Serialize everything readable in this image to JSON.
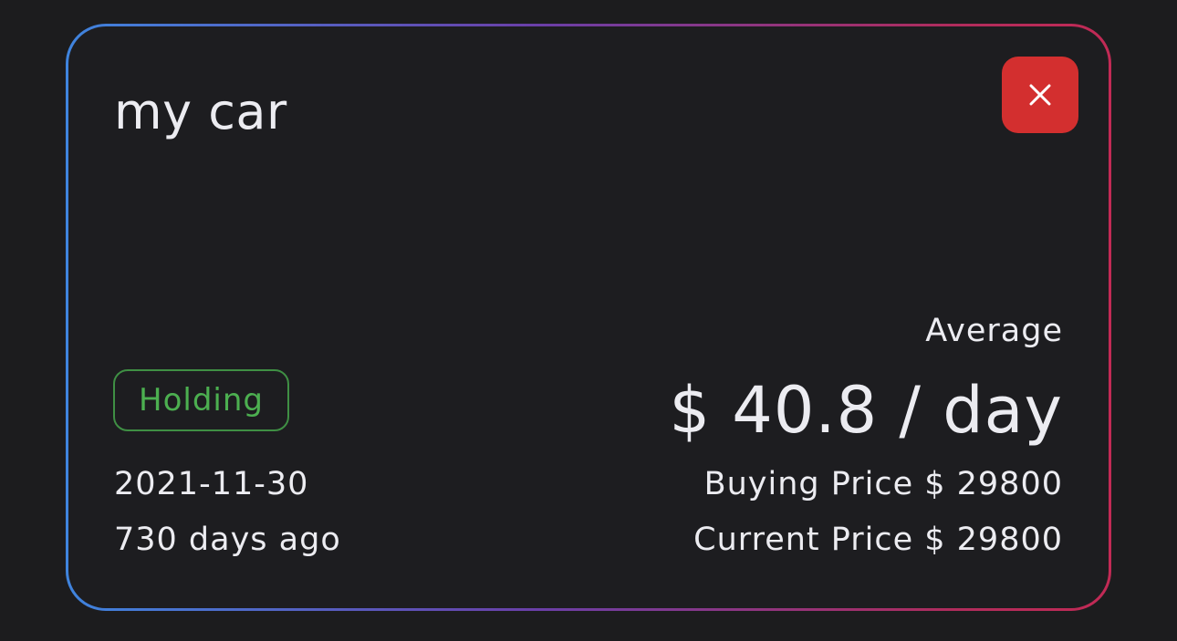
{
  "card": {
    "title": "my car",
    "close_label": "×",
    "status": "Holding",
    "date": "2021-11-30",
    "days_ago": "730 days ago",
    "average_label": "Average",
    "average_value": "$ 40.8 / day",
    "buying_price": "Buying Price $ 29800",
    "current_price": "Current Price $ 29800"
  },
  "colors": {
    "background": "#1c1c1e",
    "card": "#1d1d20",
    "close_button": "#d32f2f",
    "status_green": "#4caf50",
    "gradient_start": "#3f84de",
    "gradient_end": "#c22a55"
  },
  "icons": {
    "close": "close-icon"
  }
}
